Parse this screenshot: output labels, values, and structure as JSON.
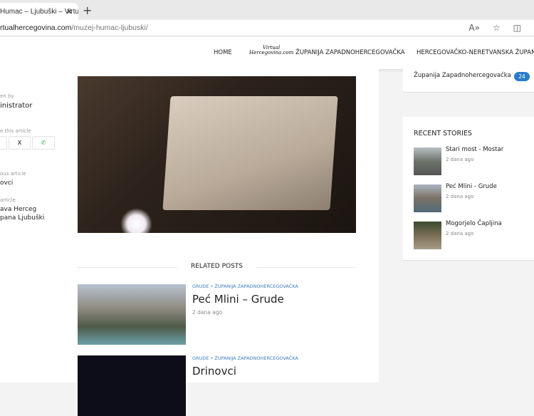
{
  "browser": {
    "tab_title": "Humac – Ljubuški – Virtual",
    "url_domain": "rtualhercegovina.com",
    "url_path": "/muzej-humac-ljubuski/"
  },
  "nav": {
    "items": [
      "HOME",
      "ŽUPANIJA ZAPADNOHERCEGOVAČKA",
      "HERCEGOVAČKO-NERETVANSKA ŽUPANIJA"
    ],
    "logo_text": "Virtual Hercegovina.com"
  },
  "article_meta": {
    "written_by_label": "en by",
    "author": "inistrator",
    "share_label": "e this article",
    "share": [
      "f",
      "X",
      "whatsapp"
    ],
    "prev_label": "ous article",
    "prev_title": "ovci",
    "next_label": "article",
    "next_title_line1": "ava Herceg",
    "next_title_line2": "pana Ljubuški"
  },
  "related": {
    "heading": "RELATED POSTS",
    "posts": [
      {
        "cat1": "GRUDE",
        "cat2": "ŽUPANIJA ZAPADNOHERCEGOVAČKA",
        "title": "Peć Mlini – Grude",
        "date": "2 dana ago"
      },
      {
        "cat1": "GRUDE",
        "cat2": "ŽUPANIJA ZAPADNOHERCEGOVAČKA",
        "title": "Drinovci"
      }
    ]
  },
  "sidebar": {
    "category": "Županija Zapadnohercegovačka",
    "category_count": "24",
    "recent_title": "RECENT STORIES",
    "recent": [
      {
        "title": "Stari most - Mostar",
        "date": "2 dana ago"
      },
      {
        "title": "Peć Mlini - Grude",
        "date": "2 dana ago"
      },
      {
        "title": "Mogorjelo Čapljina",
        "date": "2 dana ago"
      }
    ]
  }
}
